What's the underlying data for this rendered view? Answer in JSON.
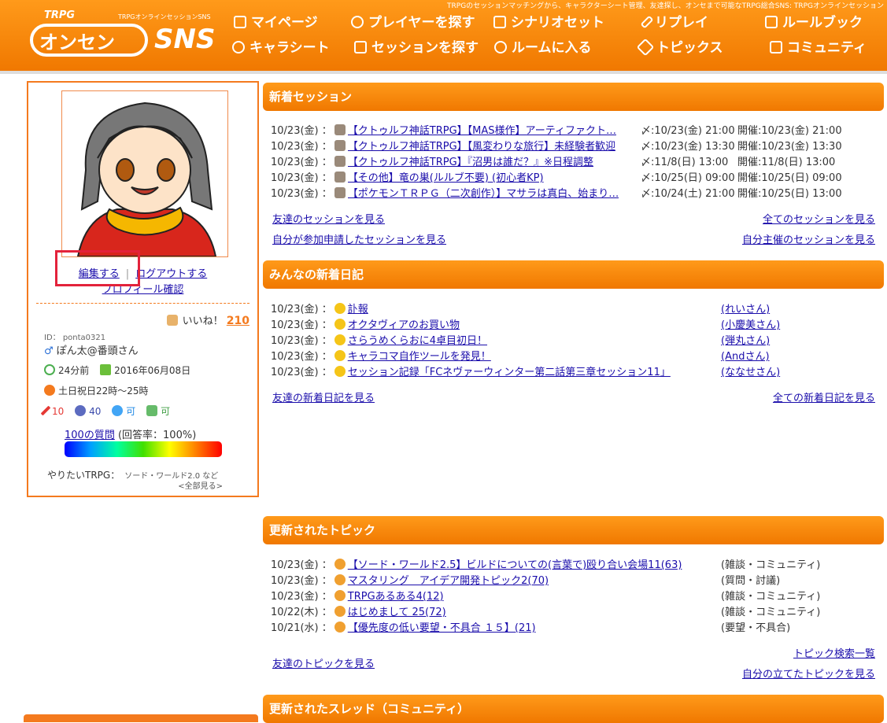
{
  "header": {
    "tagline": "TRPGのセッションマッチングから、キャラクターシート管理、友達探し、オンセまで可能なTRPG総合SNS: TRPGオンラインセッション",
    "logo_top": "TRPG",
    "logo_sub": "TRPGオンラインセッションSNS",
    "logo_main": "オンセン",
    "logo_sns": "SNS",
    "nav": [
      {
        "label": "マイページ",
        "icon": "page-icon"
      },
      {
        "label": "プレイヤーを探す",
        "icon": "player-icon"
      },
      {
        "label": "シナリオセット",
        "icon": "book-icon"
      },
      {
        "label": "リプレイ",
        "icon": "pen-icon"
      },
      {
        "label": "ルールブック",
        "icon": "books-icon"
      },
      {
        "label": "キャラシート",
        "icon": "person-icon"
      },
      {
        "label": "セッションを探す",
        "icon": "dice-icon"
      },
      {
        "label": "ルームに入る",
        "icon": "chat-icon"
      },
      {
        "label": "トピックス",
        "icon": "tag-icon"
      },
      {
        "label": "コミュニティ",
        "icon": "building-icon"
      }
    ]
  },
  "profile": {
    "edit": "編集する",
    "logout": "ログアウトする",
    "confirm": "プロフィール確認",
    "like_label": "いいね！",
    "like_count": "210",
    "id": "ID： ponta0321",
    "name": "ぽん太@番頭さん",
    "last_login": "24分前",
    "joined": "2016年06月08日",
    "schedule": "土日祝日22時～25時",
    "stat_sword": "10",
    "stat_dice": "40",
    "stat_gm": "可",
    "stat_hand": "可",
    "questions_link": "100の質問",
    "questions_rate": "(回答率：100%)",
    "want_label": "やりたいTRPG：",
    "want_value": "ソード・ワールド2.0 など",
    "see_all": "<全部見る>"
  },
  "sessions": {
    "title": "新着セッション",
    "items": [
      {
        "date": "10/23(金) ：",
        "title": "【クトゥルフ神話TRPG】【MAS様作】アーティファクト…",
        "deadline": "〆:10/23(金) 21:00",
        "held": "開催:10/23(金) 21:00"
      },
      {
        "date": "10/23(金) ：",
        "title": "【クトゥルフ神話TRPG】【風変わりな旅行】未経験者歓迎",
        "deadline": "〆:10/23(金) 13:30",
        "held": "開催:10/23(金) 13:30"
      },
      {
        "date": "10/23(金) ：",
        "title": "【クトゥルフ神話TRPG】『沼男は誰だ？』※日程調整",
        "deadline": "〆:11/8(日) 13:00",
        "held": "開催:11/8(日) 13:00"
      },
      {
        "date": "10/23(金) ：",
        "title": "【その他】竜の巣(ルルブ不要) (初心者KP)",
        "deadline": "〆:10/25(日) 09:00",
        "held": "開催:10/25(日) 09:00"
      },
      {
        "date": "10/23(金) ：",
        "title": "【ポケモンＴＲＰＧ（二次創作）】マサラは真白、始まり…",
        "deadline": "〆:10/24(土) 21:00",
        "held": "開催:10/25(日) 13:00"
      }
    ],
    "friends_link": "友達のセッションを見る",
    "all_link": "全てのセッションを見る",
    "applied_link": "自分が参加申請したセッションを見る",
    "hosted_link": "自分主催のセッションを見る"
  },
  "diary": {
    "title": "みんなの新着日記",
    "items": [
      {
        "date": "10/23(金) ：",
        "title": "訃報",
        "author": "(れいさん)"
      },
      {
        "date": "10/23(金) ：",
        "title": "オクタヴィアのお買い物",
        "author": "(小慶美さん)"
      },
      {
        "date": "10/23(金) ：",
        "title": "さらうめくらおに4卓目初日！",
        "author": "(弾丸さん)"
      },
      {
        "date": "10/23(金) ：",
        "title": "キャラコマ自作ツールを発見！",
        "author": "(Andさん)"
      },
      {
        "date": "10/23(金) ：",
        "title": "セッション記録「FCネヴァーウィンター第二話第三章セッション11」",
        "author": "(ななせさん)"
      }
    ],
    "friends_link": "友達の新着日記を見る",
    "all_link": "全ての新着日記を見る"
  },
  "topics": {
    "title": "更新されたトピック",
    "items": [
      {
        "date": "10/23(金) ：",
        "title": "【ソード・ワールド2.5】ビルドについての(言葉で)殴り合い会場11(63)",
        "cat": "(雑談・コミュニティ)"
      },
      {
        "date": "10/23(金) ：",
        "title": "マスタリング　アイデア開発トピック2(70)",
        "cat": "(質問・討議)"
      },
      {
        "date": "10/23(金) ：",
        "title": "TRPGあるある4(12)",
        "cat": "(雑談・コミュニティ)"
      },
      {
        "date": "10/22(木) ：",
        "title": "はじめまして 25(72)",
        "cat": "(雑談・コミュニティ)"
      },
      {
        "date": "10/21(水) ：",
        "title": "【優先度の低い要望・不具合 １５】(21)",
        "cat": "(要望・不具合)"
      }
    ],
    "friends_link": "友達のトピックを見る",
    "search_link": "トピック検索一覧",
    "mine_link": "自分の立てたトピックを見る"
  },
  "threads": {
    "title": "更新されたスレッド（コミュニティ）"
  }
}
